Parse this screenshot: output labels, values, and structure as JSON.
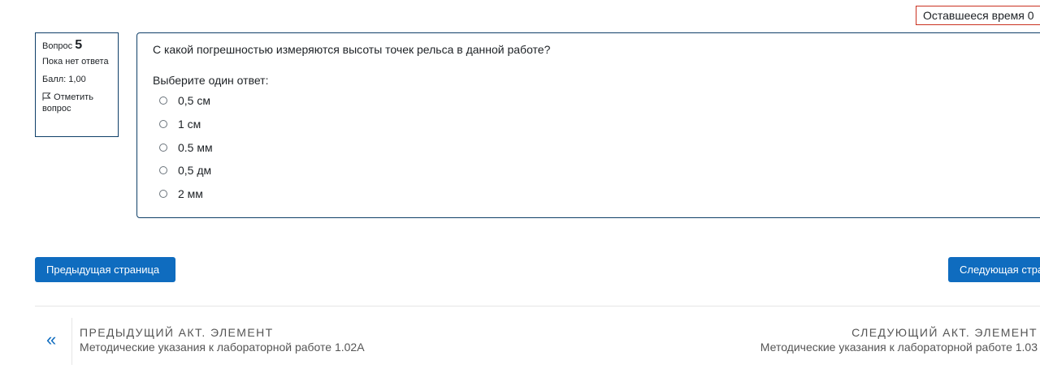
{
  "timer": {
    "label": "Оставшееся время 0"
  },
  "question_info": {
    "label": "Вопрос",
    "number": "5",
    "status": "Пока нет ответа",
    "grade": "Балл: 1,00",
    "flag_label": "Отметить вопрос"
  },
  "question": {
    "text": "С какой погрешностью измеряются высоты точек рельса в данной работе?",
    "prompt": "Выберите один ответ:",
    "answers": [
      {
        "label": "0,5 см"
      },
      {
        "label": "1 см"
      },
      {
        "label": "0.5 мм"
      },
      {
        "label": "0,5 дм"
      },
      {
        "label": "2 мм"
      }
    ]
  },
  "buttons": {
    "prev_label": "Предыдущая страница",
    "next_label": "Следующая стра"
  },
  "activity_nav": {
    "prev_kicker": "ПРЕДЫДУЩИЙ АКТ. ЭЛЕМЕНТ",
    "prev_title": "Методические указания к лабораторной работе 1.02А",
    "prev_arrow": "«",
    "next_kicker": "СЛЕДУЮЩИЙ АКТ. ЭЛЕМЕНТ",
    "next_title": "Методические указания к лабораторной работе 1.03"
  },
  "colors": {
    "accent": "#0f6cbf",
    "border": "#0f3f68",
    "timer_border": "#ca3120"
  }
}
